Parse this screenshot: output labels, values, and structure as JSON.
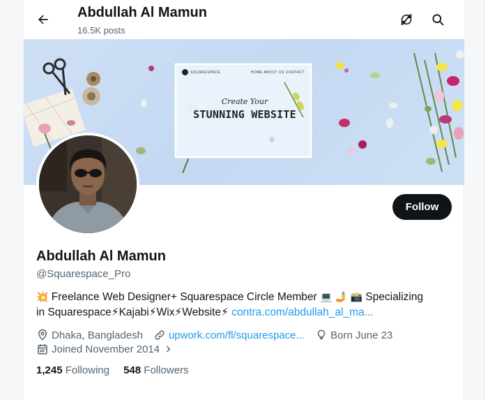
{
  "header": {
    "title": "Abdullah Al Mamun",
    "subtitle": "16.5K posts"
  },
  "banner": {
    "mock_brand": "SQUARESPACE",
    "mock_links": "HOME   ABOUT US   CONTACT",
    "headline_1": "Create Your",
    "headline_2": "STUNNING WEBSITE"
  },
  "profile": {
    "name": "Abdullah Al Mamun",
    "handle": "@Squarespace_Pro",
    "follow_label": "Follow",
    "bio": {
      "line1_text": "Freelance Web Designer+ Squarespace Circle Member",
      "line1_tail": "Specializing",
      "line2_text": "in Squarespace⚡Kajabi⚡Wix⚡Website⚡",
      "line2_link": "contra.com/abdullah_al_ma..."
    },
    "location": "Dhaka, Bangladesh",
    "website": "upwork.com/fl/squarespace...",
    "born": "Born June 23",
    "joined": "Joined November 2014",
    "following_count": "1,245",
    "following_label": "Following",
    "followers_count": "548",
    "followers_label": "Followers"
  },
  "colors": {
    "accent": "#1d9bf0",
    "text": "#0f1419",
    "muted": "#536471",
    "button": "#0f1419"
  },
  "icons": [
    "back-arrow-icon",
    "repeat-sync-icon",
    "search-icon",
    "location-pin-icon",
    "link-icon",
    "balloon-icon",
    "calendar-icon",
    "chevron-right-icon"
  ]
}
